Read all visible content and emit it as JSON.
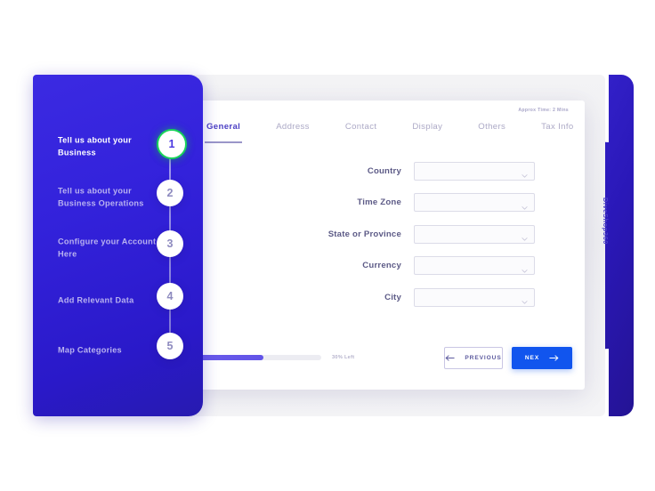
{
  "brand": {
    "name": "DiveShop360"
  },
  "sidebar": {
    "steps": [
      {
        "number": "1",
        "label": "Tell us about your Business",
        "state": "active"
      },
      {
        "number": "2",
        "label": "Tell us about your Business Operations",
        "state": "pending"
      },
      {
        "number": "3",
        "label": "Configure your Account Here",
        "state": "pending"
      },
      {
        "number": "4",
        "label": "Add Relevant Data",
        "state": "pending"
      },
      {
        "number": "5",
        "label": "Map Categories",
        "state": "pending"
      }
    ]
  },
  "card": {
    "approx_time": "Approx Time: 2 Mins",
    "tabs": [
      {
        "label": "General",
        "active": true
      },
      {
        "label": "Address",
        "active": false
      },
      {
        "label": "Contact",
        "active": false
      },
      {
        "label": "Display",
        "active": false
      },
      {
        "label": "Others",
        "active": false
      },
      {
        "label": "Tax Info",
        "active": false
      }
    ],
    "fields": [
      {
        "label": "Country",
        "value": "",
        "placeholder": ""
      },
      {
        "label": "Time Zone",
        "value": "",
        "placeholder": ""
      },
      {
        "label": "State or Province",
        "value": "",
        "placeholder": ""
      },
      {
        "label": "Currency",
        "value": "",
        "placeholder": ""
      },
      {
        "label": "City",
        "value": "",
        "placeholder": ""
      }
    ],
    "footer": {
      "progress_percent": 52,
      "progress_text": "30% Left",
      "previous_label": "PREVIOUS",
      "next_label": "NEX"
    }
  },
  "colors": {
    "sidebar_blue": "#3322DB",
    "accent_blue": "#1155EE",
    "progress_fill": "#6A5BEA",
    "step_done_ring": "#19D45A",
    "label_text": "#5C5A86",
    "muted_text": "#ACA9C6"
  }
}
